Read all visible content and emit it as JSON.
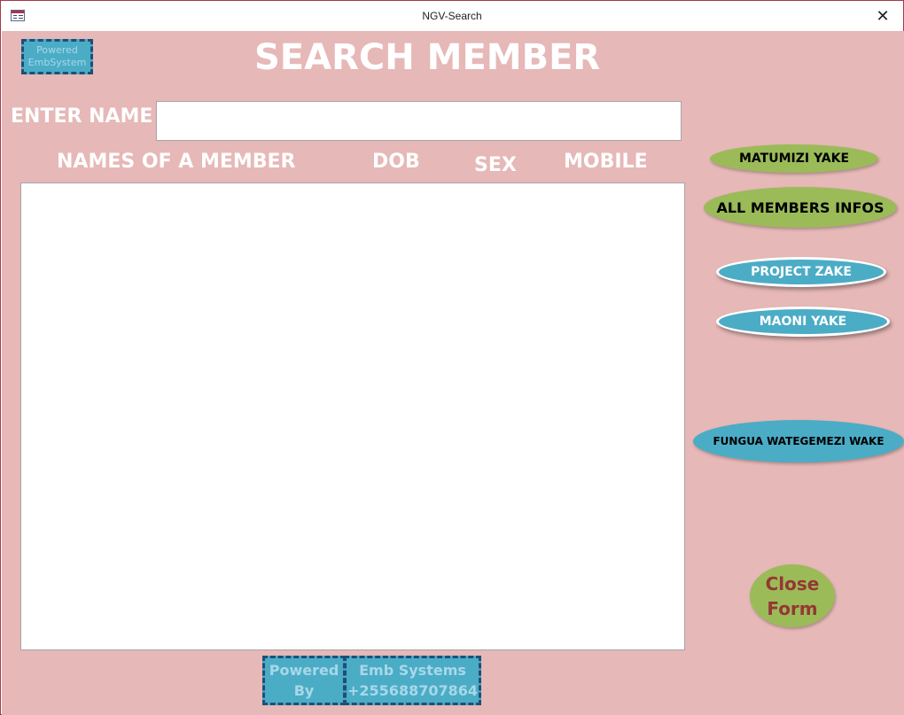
{
  "window": {
    "title": "NGV-Search",
    "close_glyph": "✕",
    "icon": "form-icon"
  },
  "form": {
    "heading": "SEARCH MEMBER",
    "top_badge": {
      "line1": "Powered",
      "line2": "EmbSystem"
    },
    "search": {
      "label": "ENTER NAME",
      "value": "",
      "placeholder": ""
    },
    "columns": [
      "NAMES OF A MEMBER",
      "DOB",
      "SEX",
      "MOBILE"
    ],
    "results": [],
    "buttons": {
      "matumizi": "MATUMIZI YAKE",
      "all_members": "ALL MEMBERS INFOS",
      "project": "PROJECT ZAKE",
      "maoni": "MAONI YAKE",
      "fungua": "FUNGUA WATEGEMEZI WAKE",
      "close_line1": "Close",
      "close_line2": "Form"
    },
    "footer": {
      "powered_line1": "Powered",
      "powered_line2": "By",
      "company_line1": "Emb Systems",
      "company_line2": "+255688707864"
    }
  },
  "colors": {
    "form_background": "#e6b8b7",
    "green_button": "#9bbb59",
    "blue_button": "#4bacc6",
    "badge_border": "#1f4e79",
    "close_text": "#953734"
  }
}
